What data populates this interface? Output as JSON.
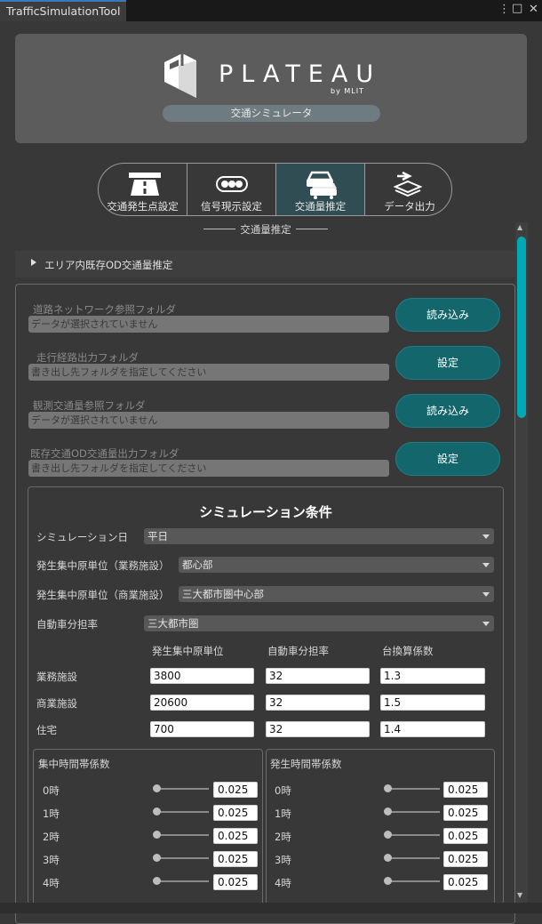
{
  "window": {
    "tab_title": "TrafficSimulationTool",
    "menu_glyph": "⋮",
    "max_glyph": "□",
    "close_glyph": "✕"
  },
  "header": {
    "logo_text": "PLATEAU",
    "logo_sub": "by MLIT",
    "app_name": "交通シミュレータ"
  },
  "mode_tabs": [
    {
      "label": "交通発生点設定",
      "icon": "road-icon",
      "active": false
    },
    {
      "label": "信号現示設定",
      "icon": "traffic-light-icon",
      "active": false
    },
    {
      "label": "交通量推定",
      "icon": "cars-icon",
      "active": true
    },
    {
      "label": "データ出力",
      "icon": "layers-export-icon",
      "active": false
    }
  ],
  "section_title": "交通量推定",
  "foldout": {
    "label": "エリア内既存OD交通量推定"
  },
  "folders": [
    {
      "label": "道路ネットワーク参照フォルダ",
      "value": "データが選択されていません",
      "button": "読み込み"
    },
    {
      "label": "走行経路出力フォルダ",
      "value": "書き出し先フォルダを指定してください",
      "button": "設定"
    },
    {
      "label": "観測交通量参照フォルダ",
      "value": "データが選択されていません",
      "button": "読み込み"
    },
    {
      "label": "既存交通OD交通量出力フォルダ",
      "value": "書き出し先フォルダを指定してください",
      "button": "設定"
    }
  ],
  "conditions": {
    "title": "シミュレーション条件",
    "simulation_day": {
      "label": "シミュレーション日",
      "value": "平日"
    },
    "business_unit": {
      "label": "発生集中原単位（業務施設）",
      "value": "都心部"
    },
    "commercial_unit": {
      "label": "発生集中原単位（商業施設）",
      "value": "三大都市圏中心部"
    },
    "car_share": {
      "label": "自動車分担率",
      "value": "三大都市圏"
    },
    "columns": [
      "発生集中原単位",
      "自動車分担率",
      "台換算係数"
    ],
    "rows": [
      {
        "label": "業務施設",
        "values": [
          "3800",
          "32",
          "1.3"
        ]
      },
      {
        "label": "商業施設",
        "values": [
          "20600",
          "32",
          "1.5"
        ]
      },
      {
        "label": "住宅",
        "values": [
          "700",
          "32",
          "1.4"
        ]
      }
    ],
    "concentration": {
      "title": "集中時間帯係数",
      "hours": [
        {
          "label": "0時",
          "value": "0.025"
        },
        {
          "label": "1時",
          "value": "0.025"
        },
        {
          "label": "2時",
          "value": "0.025"
        },
        {
          "label": "3時",
          "value": "0.025"
        },
        {
          "label": "4時",
          "value": "0.025"
        }
      ]
    },
    "generation": {
      "title": "発生時間帯係数",
      "hours": [
        {
          "label": "0時",
          "value": "0.025"
        },
        {
          "label": "1時",
          "value": "0.025"
        },
        {
          "label": "2時",
          "value": "0.025"
        },
        {
          "label": "3時",
          "value": "0.025"
        },
        {
          "label": "4時",
          "value": "0.025"
        }
      ]
    }
  },
  "colors": {
    "accent": "#00a9b5",
    "button": "#13676c",
    "active_tab": "#2f4d52"
  }
}
